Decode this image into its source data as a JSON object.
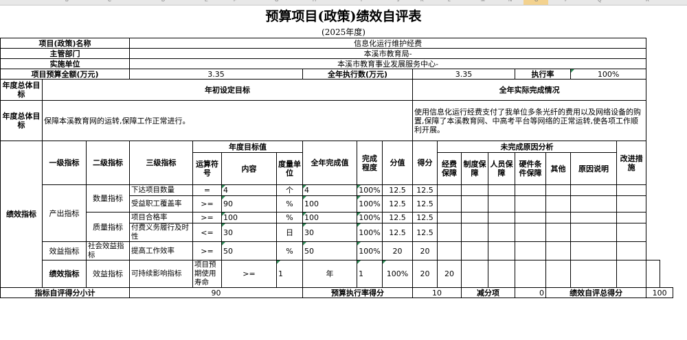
{
  "col_letters": [
    "B",
    "C",
    "D",
    "E",
    "F",
    "G",
    "H",
    "I",
    "J",
    "K",
    "L",
    "M",
    "N",
    "O",
    "P",
    "Q",
    "R"
  ],
  "title": "预算项目(政策)绩效自评表",
  "subtitle": "(2025年度)",
  "info": {
    "project_name_label": "项目(政策)名称",
    "project_name": "信息化运行维护经费",
    "dept_label": "主管部门",
    "dept": "本溪市教育局-",
    "unit_label": "实施单位",
    "unit": "本溪市教育事业发展服务中心-",
    "budget_label": "项目预算全额(万元)",
    "budget": "3.35",
    "executed_label": "全年执行数(万元)",
    "executed": "3.35",
    "rate_label": "执行率",
    "rate": "100%"
  },
  "goals": {
    "header_label": "年度总体目标",
    "initial_label": "年初设定目标",
    "actual_label": "全年实际完成情况",
    "row_label": "年度总体目标",
    "initial_text": "保障本溪教育网的运转,保障工作正常进行。",
    "actual_text": "使用信息化运行经费支付了我单位多条光纤的费用以及网络设备的购置,保障了本溪教育网、中高考平台等网络的正常运转,使各项工作顺利开展。"
  },
  "headers": {
    "perf_indicator": "绩效指标",
    "level1": "一级指标",
    "level2": "二级指标",
    "level3": "三级指标",
    "target_group": "年度目标值",
    "operator": "运算符号",
    "content": "内容",
    "unit": "度量单位",
    "annual_value": "全年完成值",
    "degree": "完成程度",
    "score_value": "分值",
    "score": "得分",
    "reason_group": "未完成原因分析",
    "reason_funding": "经费保障",
    "reason_system": "制度保障",
    "reason_staff": "人员保障",
    "reason_hardware": "硬件条件保障",
    "reason_other": "其他",
    "reason_note": "原因说明",
    "improve": "改进措施"
  },
  "rows": [
    {
      "l1": "产出指标",
      "l2": "数量指标",
      "l3": "下达项目数量",
      "op": "=",
      "content": "4",
      "unit": "个",
      "value": "4",
      "degree": "100%",
      "full": "12.5",
      "score": "12.5"
    },
    {
      "l1": "",
      "l2": "",
      "l3": "受益职工覆盖率",
      "op": ">=",
      "content": "90",
      "unit": "%",
      "value": "100",
      "degree": "100%",
      "full": "12.5",
      "score": "12.5"
    },
    {
      "l1": "",
      "l2": "质量指标",
      "l3": "项目合格率",
      "op": ">=",
      "content": "100",
      "unit": "%",
      "value": "100",
      "degree": "100%",
      "full": "12.5",
      "score": "12.5"
    },
    {
      "l1": "",
      "l2": "",
      "l3": "付费义务履行及时性",
      "op": "<=",
      "content": "30",
      "unit": "日",
      "value": "30",
      "degree": "100%",
      "full": "12.5",
      "score": "12.5"
    },
    {
      "l1": "效益指标",
      "l2": "社会效益指标",
      "l3": "提高工作效率",
      "op": ">=",
      "content": "50",
      "unit": "%",
      "value": "50",
      "degree": "100%",
      "full": "20",
      "score": "20"
    },
    {
      "l1": "效益指标",
      "l2": "可持续影响指标",
      "l3": "项目预期使用寿命",
      "op": ">=",
      "content": "1",
      "unit": "年",
      "value": "1",
      "degree": "100%",
      "full": "20",
      "score": "20"
    }
  ],
  "footer": {
    "subtotal_label": "指标自评得分小计",
    "subtotal": "90",
    "rate_score_label": "预算执行率得分",
    "rate_score": "10",
    "deduct_label": "减分项",
    "deduct": "0",
    "total_label": "绩效自评总得分",
    "total": "100"
  }
}
